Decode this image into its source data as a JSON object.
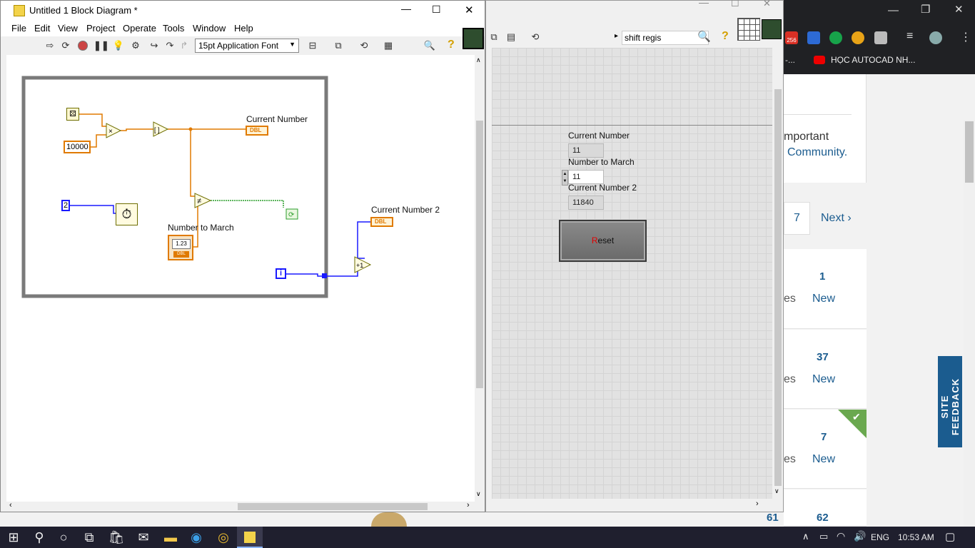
{
  "browser": {
    "tab_text": "-...",
    "bookmark_youtube": "HỌC AUTOCAD NH...",
    "gmail_badge": "256",
    "important_text": "mportant",
    "community_text": "Community.",
    "pagination_current": "7",
    "pagination_next": "Next",
    "rows": [
      {
        "count": "1",
        "label": "New",
        "partial": "es"
      },
      {
        "count": "37",
        "label": "New",
        "partial": "es"
      },
      {
        "count": "7",
        "label": "New",
        "partial": "es"
      },
      {
        "count": "62",
        "label": "",
        "partial": "61"
      }
    ],
    "site_feedback": "SITE FEEDBACK"
  },
  "front_panel": {
    "search_value": "shift regis",
    "current_number_label": "Current Number",
    "current_number_value": "11",
    "number_to_march_label": "Number to March",
    "number_to_march_value": "11",
    "current_number2_label": "Current Number 2",
    "current_number2_value": "11840",
    "reset_label_first": "R",
    "reset_label_rest": "eset"
  },
  "block_diagram": {
    "title": "Untitled 1 Block Diagram *",
    "menu": [
      "File",
      "Edit",
      "View",
      "Project",
      "Operate",
      "Tools",
      "Window",
      "Help"
    ],
    "font_select": "15pt Application Font",
    "const_10000": "10000",
    "const_2": "2",
    "label_current_number": "Current Number",
    "label_number_to_march": "Number to March",
    "label_current_number2": "Current Number 2",
    "dbl_tag": "DBL",
    "numeric_control_text": "1.23",
    "iteration_terminal": "i",
    "increment_symbol": "+1"
  },
  "taskbar": {
    "language": "ENG",
    "time": "10:53 AM"
  },
  "colors": {
    "orange_wire": "#e07a00",
    "blue_wire": "#1a1aff",
    "green_wire": "#2a9d2a",
    "link_blue": "#1b5c8f",
    "site_feedback_bg": "#1b5c8f",
    "reset_red": "#e00000"
  }
}
